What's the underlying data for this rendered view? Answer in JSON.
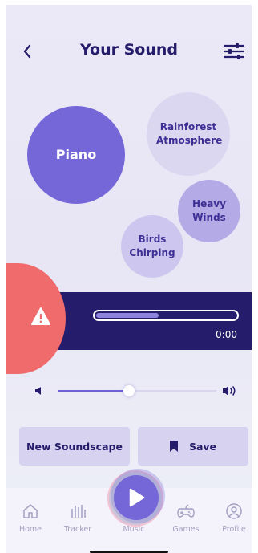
{
  "header": {
    "title": "Your Sound",
    "back_icon": "chevron-left-icon",
    "settings_icon": "sliders-icon"
  },
  "sounds": [
    {
      "name": "Piano",
      "color": "#7567d8"
    },
    {
      "name": "Rainforest Atmosphere",
      "color": "#dcd7f1"
    },
    {
      "name": "Heavy Winds",
      "color": "#b4abe6"
    },
    {
      "name": "Birds Chirping",
      "color": "#cdc6ee"
    }
  ],
  "player": {
    "time": "0:00",
    "progress": 0.45,
    "alert_icon": "warning-icon",
    "bar_color": "#251d6b",
    "alert_color": "#f06b6b"
  },
  "volume": {
    "level": 0.45,
    "low_icon": "volume-low-icon",
    "high_icon": "volume-high-icon"
  },
  "actions": {
    "new_label": "New Soundscape",
    "save_label": "Save",
    "save_icon": "bookmark-icon"
  },
  "nav": {
    "items": [
      {
        "label": "Home",
        "icon": "home-icon"
      },
      {
        "label": "Tracker",
        "icon": "tracker-icon"
      },
      {
        "label": "Music",
        "icon": "music-icon"
      },
      {
        "label": "Games",
        "icon": "gamepad-icon"
      },
      {
        "label": "Profile",
        "icon": "profile-icon"
      }
    ],
    "play_icon": "play-icon"
  }
}
